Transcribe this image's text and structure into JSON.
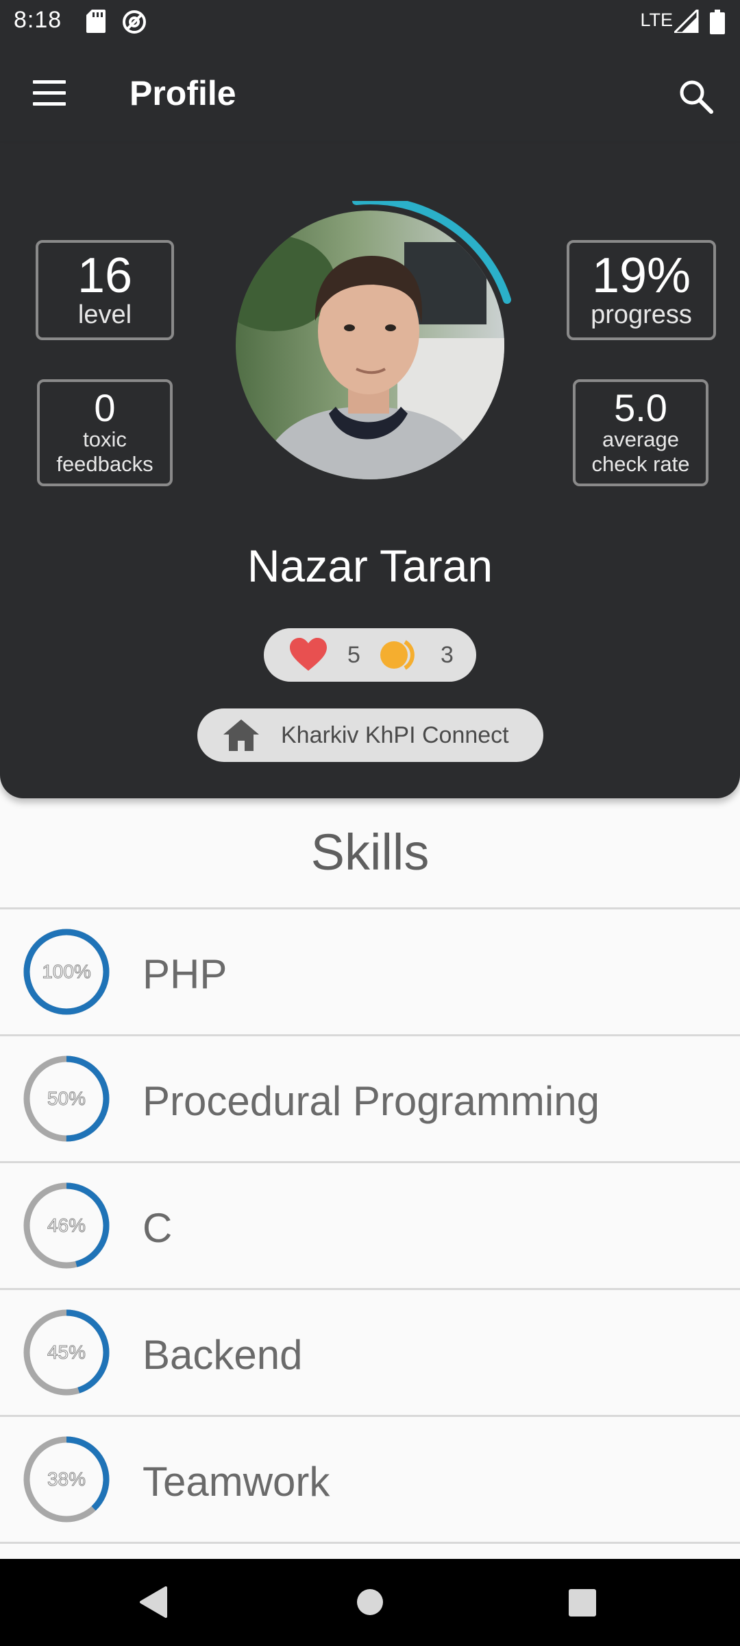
{
  "status_bar": {
    "time": "8:18",
    "network": "LTE"
  },
  "app_bar": {
    "title": "Profile"
  },
  "profile": {
    "level": {
      "value": "16",
      "label": "level"
    },
    "progress": {
      "value": "19%",
      "label": "progress",
      "fraction": 0.19
    },
    "toxic": {
      "value": "0",
      "label_line1": "toxic",
      "label_line2": "feedbacks"
    },
    "rate": {
      "value": "5.0",
      "label_line1": "average",
      "label_line2": "check rate"
    },
    "name": "Nazar Taran",
    "likes": "5",
    "coins": "3",
    "location": "Kharkiv KhPI Connect"
  },
  "skills": {
    "title": "Skills",
    "items": [
      {
        "name": "PHP",
        "percent_label": "100%",
        "fraction": 1.0
      },
      {
        "name": "Procedural Programming",
        "percent_label": "50%",
        "fraction": 0.5
      },
      {
        "name": "C",
        "percent_label": "46%",
        "fraction": 0.46
      },
      {
        "name": "Backend",
        "percent_label": "45%",
        "fraction": 0.45
      },
      {
        "name": "Teamwork",
        "percent_label": "38%",
        "fraction": 0.38
      }
    ]
  },
  "colors": {
    "accent_ring": "#2bb0c9",
    "skill_ring": "#1f73b7",
    "header_bg": "#2b2c2e",
    "heart": "#e85050",
    "coin": "#f5ae2f"
  },
  "icons": [
    "sd-card-icon",
    "at-icon",
    "signal-icon",
    "battery-icon",
    "menu-icon",
    "search-icon",
    "heart-icon",
    "coin-icon",
    "home-icon",
    "back-icon",
    "home-circle-icon",
    "recents-icon"
  ]
}
